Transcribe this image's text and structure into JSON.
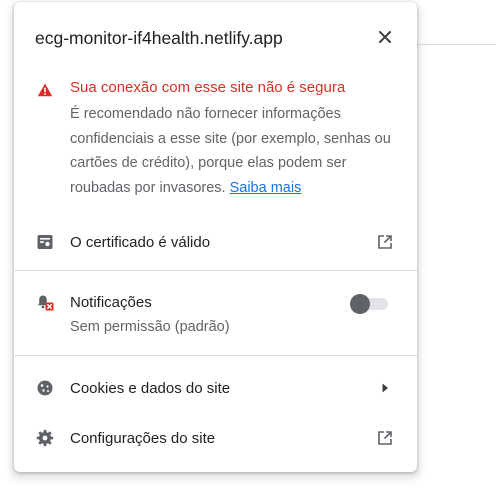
{
  "popup": {
    "site_host": "ecg-monitor-if4health.netlify.app",
    "close_icon": "close-icon"
  },
  "security_warning": {
    "icon": "warning-triangle-icon",
    "title": "Sua conexão com esse site não é segura",
    "body": "É recomendado não fornecer informações confidenciais a esse site (por exemplo, senhas ou cartões de crédito), porque elas podem ser roubadas por invasores.",
    "learn_more": "Saiba mais",
    "color": "#d93025",
    "link_color": "#1a73e8"
  },
  "certificate": {
    "icon": "certificate-icon",
    "label": "O certificado é válido",
    "trailing_icon": "open-external-icon"
  },
  "notifications": {
    "icon": "notifications-blocked-icon",
    "label": "Notificações",
    "status": "Sem permissão (padrão)",
    "toggle_on": false
  },
  "cookies": {
    "icon": "cookie-icon",
    "label": "Cookies e dados do site",
    "trailing_icon": "arrow-right-icon"
  },
  "site_settings": {
    "icon": "gear-icon",
    "label": "Configurações do site",
    "trailing_icon": "open-external-icon"
  }
}
